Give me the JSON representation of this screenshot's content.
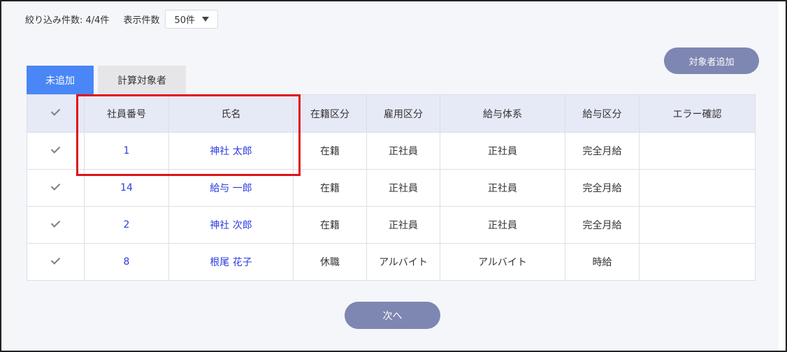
{
  "filter": {
    "count_label": "絞り込み件数: 4/4件",
    "per_page_label": "表示件数",
    "per_page_value": "50件"
  },
  "actions": {
    "add_target": "対象者追加",
    "next": "次へ"
  },
  "tabs": [
    {
      "label": "未追加",
      "active": true
    },
    {
      "label": "計算対象者",
      "active": false
    }
  ],
  "table": {
    "headers": [
      "社員番号",
      "氏名",
      "在籍区分",
      "雇用区分",
      "給与体系",
      "給与区分",
      "エラー確認"
    ],
    "rows": [
      {
        "checked": true,
        "id": "1",
        "name": "神社 太郎",
        "enrollment": "在籍",
        "employment": "正社員",
        "pay_system": "正社員",
        "pay_type": "完全月給",
        "error": ""
      },
      {
        "checked": true,
        "id": "14",
        "name": "給与 一郎",
        "enrollment": "在籍",
        "employment": "正社員",
        "pay_system": "正社員",
        "pay_type": "完全月給",
        "error": ""
      },
      {
        "checked": true,
        "id": "2",
        "name": "神社 次郎",
        "enrollment": "在籍",
        "employment": "正社員",
        "pay_system": "正社員",
        "pay_type": "完全月給",
        "error": ""
      },
      {
        "checked": true,
        "id": "8",
        "name": "根尾 花子",
        "enrollment": "休職",
        "employment": "アルバイト",
        "pay_system": "アルバイト",
        "pay_type": "時給",
        "error": ""
      }
    ]
  },
  "colors": {
    "accent": "#4a86f6",
    "button": "#7e86b2",
    "link": "#2b3de0",
    "highlight": "#e0121a"
  }
}
